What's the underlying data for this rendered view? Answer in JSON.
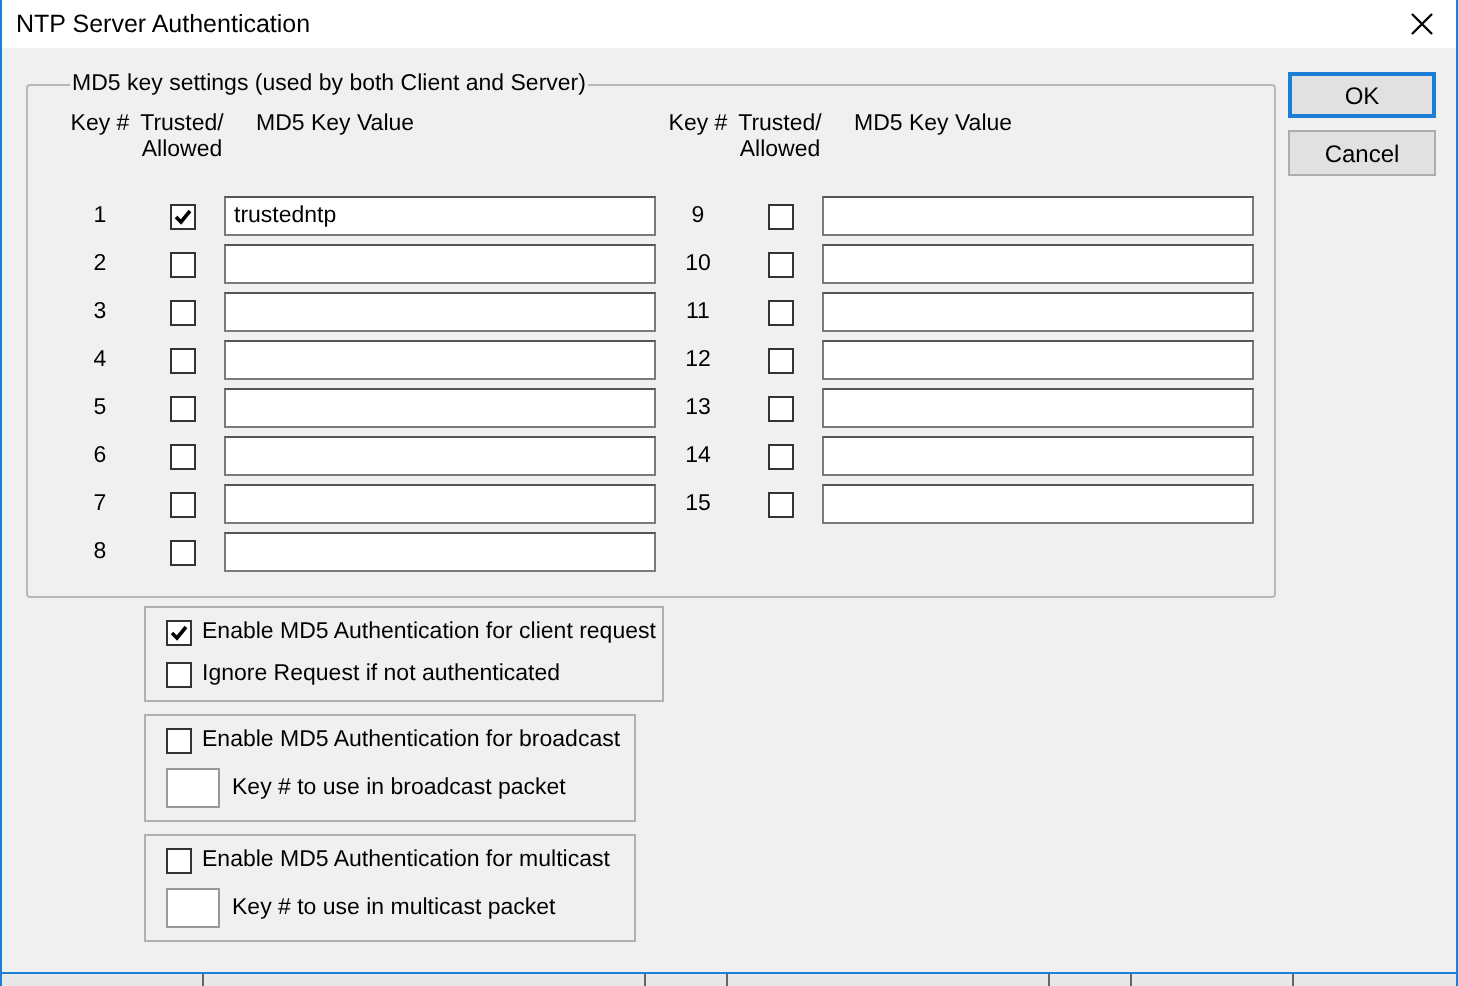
{
  "window": {
    "title": "NTP Server Authentication"
  },
  "md5_group": {
    "label": "MD5 key settings (used by both Client and Server)",
    "columns": [
      {
        "headers": {
          "key": "Key #",
          "trusted": "Trusted/\nAllowed",
          "value": "MD5 Key Value"
        },
        "keys": [
          {
            "key": "1",
            "trusted": true,
            "value": "trustedntp"
          },
          {
            "key": "2",
            "trusted": false
          },
          {
            "key": "3",
            "trusted": false
          },
          {
            "key": "4",
            "trusted": false
          },
          {
            "key": "5",
            "trusted": false
          },
          {
            "key": "6",
            "trusted": false
          },
          {
            "key": "7",
            "trusted": false
          },
          {
            "key": "8",
            "trusted": false
          }
        ]
      },
      {
        "headers": {
          "key": "Key #",
          "trusted": "Trusted/\nAllowed",
          "value": "MD5 Key Value"
        },
        "keys": [
          {
            "key": "9",
            "trusted": false
          },
          {
            "key": "10",
            "trusted": false
          },
          {
            "key": "11",
            "trusted": false
          },
          {
            "key": "12",
            "trusted": false
          },
          {
            "key": "13",
            "trusted": false
          },
          {
            "key": "14",
            "trusted": false
          },
          {
            "key": "15",
            "trusted": false
          }
        ]
      }
    ]
  },
  "option_groups": [
    {
      "items": [
        {
          "kind": "checkbox",
          "label": "Enable MD5 Authentication for client request",
          "checked": true
        },
        {
          "kind": "checkbox",
          "label": "Ignore Request if not authenticated",
          "checked": false
        }
      ]
    },
    {
      "items": [
        {
          "kind": "checkbox",
          "label": "Enable MD5 Authentication for broadcast",
          "checked": false
        },
        {
          "kind": "keyfield",
          "label": "Key # to use in broadcast packet"
        }
      ]
    },
    {
      "items": [
        {
          "kind": "checkbox",
          "label": "Enable MD5 Authentication for multicast",
          "checked": false
        },
        {
          "kind": "keyfield",
          "label": "Key # to use in multicast packet"
        }
      ]
    }
  ],
  "buttons": [
    "OK",
    "Cancel"
  ]
}
